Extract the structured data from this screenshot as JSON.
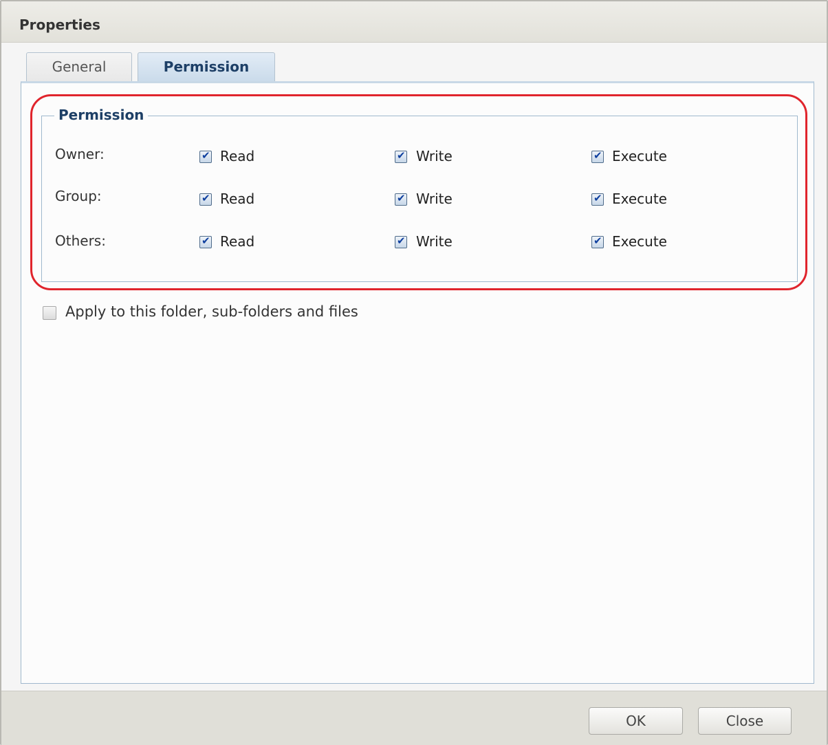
{
  "dialog": {
    "title": "Properties"
  },
  "tabs": [
    {
      "label": "General",
      "active": false
    },
    {
      "label": "Permission",
      "active": true
    }
  ],
  "permission": {
    "legend": "Permission",
    "rows": [
      {
        "label": "Owner:",
        "read": {
          "label": "Read",
          "checked": true
        },
        "write": {
          "label": "Write",
          "checked": true
        },
        "execute": {
          "label": "Execute",
          "checked": true
        }
      },
      {
        "label": "Group:",
        "read": {
          "label": "Read",
          "checked": true
        },
        "write": {
          "label": "Write",
          "checked": true
        },
        "execute": {
          "label": "Execute",
          "checked": true
        }
      },
      {
        "label": "Others:",
        "read": {
          "label": "Read",
          "checked": true
        },
        "write": {
          "label": "Write",
          "checked": true
        },
        "execute": {
          "label": "Execute",
          "checked": true
        }
      }
    ]
  },
  "apply": {
    "label": "Apply to this folder, sub-folders and files",
    "checked": false
  },
  "buttons": {
    "ok": "OK",
    "close": "Close"
  },
  "colors": {
    "highlight": "#e0242c",
    "accent": "#1d3f66",
    "checkmark": "#0e3f9e"
  }
}
